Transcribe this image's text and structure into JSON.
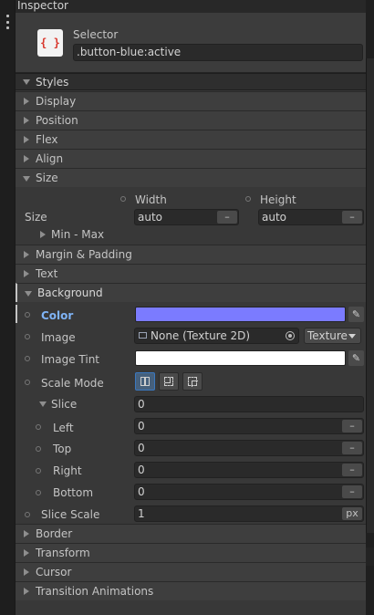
{
  "window": {
    "title": "Inspector"
  },
  "header": {
    "icon_glyph": "{ }",
    "label": "Selector",
    "selector_value": ".button-blue:active"
  },
  "styles": {
    "title": "Styles",
    "display": "Display",
    "position": "Position",
    "flex": "Flex",
    "align": "Align",
    "size": {
      "title": "Size",
      "row_label": "Size",
      "width_label": "Width",
      "height_label": "Height",
      "width_value": "auto",
      "height_value": "auto",
      "unit_glyph": "–",
      "min_max": "Min - Max"
    },
    "margin_padding": "Margin & Padding",
    "text": "Text",
    "background": {
      "title": "Background",
      "color_label": "Color",
      "color_value": "#7b7bff",
      "image_label": "Image",
      "image_value": "None (Texture 2D)",
      "image_type": "Texture",
      "image_tint_label": "Image Tint",
      "image_tint_value": "#ffffff",
      "scale_mode_label": "Scale Mode",
      "scale_mode_selected": 0,
      "slice": {
        "label": "Slice",
        "value": "0",
        "left_label": "Left",
        "left_value": "0",
        "top_label": "Top",
        "top_value": "0",
        "right_label": "Right",
        "right_value": "0",
        "bottom_label": "Bottom",
        "bottom_value": "0",
        "unit_glyph": "–"
      },
      "slice_scale_label": "Slice Scale",
      "slice_scale_value": "1",
      "slice_scale_unit": "px"
    },
    "border": "Border",
    "transform": "Transform",
    "cursor": "Cursor",
    "transition": "Transition Animations"
  },
  "icons": {
    "menu": "kebab-menu-icon",
    "selector": "selector-braces-icon",
    "eyedropper_glyph": "✎"
  }
}
